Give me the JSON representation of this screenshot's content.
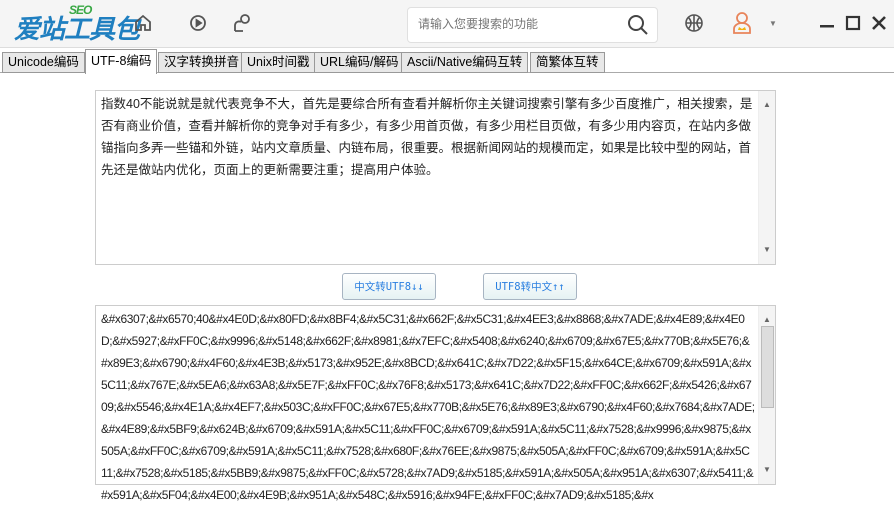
{
  "header": {
    "logo_text": "爱站工具包",
    "logo_badge": "SEO",
    "search_placeholder": "请输入您要搜索的功能"
  },
  "tabs": [
    "Unicode编码",
    "UTF-8编码",
    "汉字转换拼音",
    "Unix时间戳",
    "URL编码/解码",
    "Ascii/Native编码互转",
    "简繁体互转"
  ],
  "active_tab": "UTF-8编码",
  "input_text": "指数40不能说就是就代表竞争不大，首先是要综合所有查看并解析你主关键词搜索引擎有多少百度推广，相关搜索，是否有商业价值，查看并解析你的竞争对手有多少，有多少用首页做，有多少用栏目页做，有多少用内容页，在站内多做锚指向多弄一些锚和外链，站内文章质量、内链布局，很重要。根据新闻网站的规模而定，如果是比较中型的网站，首先还是做站内优化，页面上的更新需要注重；提高用户体验。",
  "buttons": {
    "to_utf8": "中文转UTF8↓↓",
    "to_chinese": "UTF8转中文↑↑"
  },
  "output_text": "&#x6307;&#x6570;40&#x4E0D;&#x80FD;&#x8BF4;&#x5C31;&#x662F;&#x5C31;&#x4EE3;&#x8868;&#x7ADE;&#x4E89;&#x4E0D;&#x5927;&#xFF0C;&#x9996;&#x5148;&#x662F;&#x8981;&#x7EFC;&#x5408;&#x6240;&#x6709;&#x67E5;&#x770B;&#x5E76;&#x89E3;&#x6790;&#x4F60;&#x4E3B;&#x5173;&#x952E;&#x8BCD;&#x641C;&#x7D22;&#x5F15;&#x64CE;&#x6709;&#x591A;&#x5C11;&#x767E;&#x5EA6;&#x63A8;&#x5E7F;&#xFF0C;&#x76F8;&#x5173;&#x641C;&#x7D22;&#xFF0C;&#x662F;&#x5426;&#x6709;&#x5546;&#x4E1A;&#x4EF7;&#x503C;&#xFF0C;&#x67E5;&#x770B;&#x5E76;&#x89E3;&#x6790;&#x4F60;&#x7684;&#x7ADE;&#x4E89;&#x5BF9;&#x624B;&#x6709;&#x591A;&#x5C11;&#xFF0C;&#x6709;&#x591A;&#x5C11;&#x7528;&#x9996;&#x9875;&#x505A;&#xFF0C;&#x6709;&#x591A;&#x5C11;&#x7528;&#x680F;&#x76EE;&#x9875;&#x505A;&#xFF0C;&#x6709;&#x591A;&#x5C11;&#x7528;&#x5185;&#x5BB9;&#x9875;&#xFF0C;&#x5728;&#x7AD9;&#x5185;&#x591A;&#x505A;&#x951A;&#x6307;&#x5411;&#x591A;&#x5F04;&#x4E00;&#x4E9B;&#x951A;&#x548C;&#x5916;&#x94FE;&#xFF0C;&#x7AD9;&#x5185;&#x"
}
